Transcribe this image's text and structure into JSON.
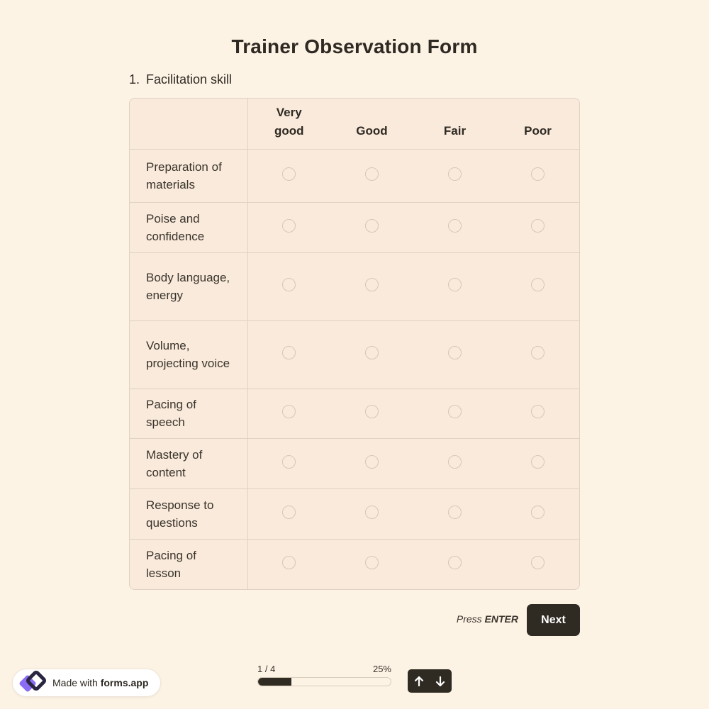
{
  "form": {
    "title": "Trainer Observation Form",
    "question_number": "1.",
    "question_label": "Facilitation skill"
  },
  "matrix": {
    "columns": [
      "Very good",
      "Good",
      "Fair",
      "Poor"
    ],
    "rows": [
      "Preparation of materials",
      "Poise and confidence",
      "Body language, energy",
      "Volume, projecting voice",
      "Pacing of speech",
      "Mastery of content",
      "Response to questions",
      "Pacing of lesson"
    ]
  },
  "actions": {
    "press_prefix": "Press",
    "press_key": "ENTER",
    "next_label": "Next"
  },
  "footer": {
    "badge_prefix": "Made with",
    "badge_brand": "forms.app",
    "page_indicator": "1 / 4",
    "percent_label": "25%",
    "progress_fraction": 0.25
  },
  "icons": {
    "logo": "forms-app-logo-icon",
    "up": "arrow-up-icon",
    "down": "arrow-down-icon"
  },
  "colors": {
    "background": "#fdf3e5",
    "panel": "#f9eadb",
    "accent_dark": "#2f2a22",
    "logo_purple": "#7b5cf0",
    "logo_dark": "#2a2540"
  }
}
